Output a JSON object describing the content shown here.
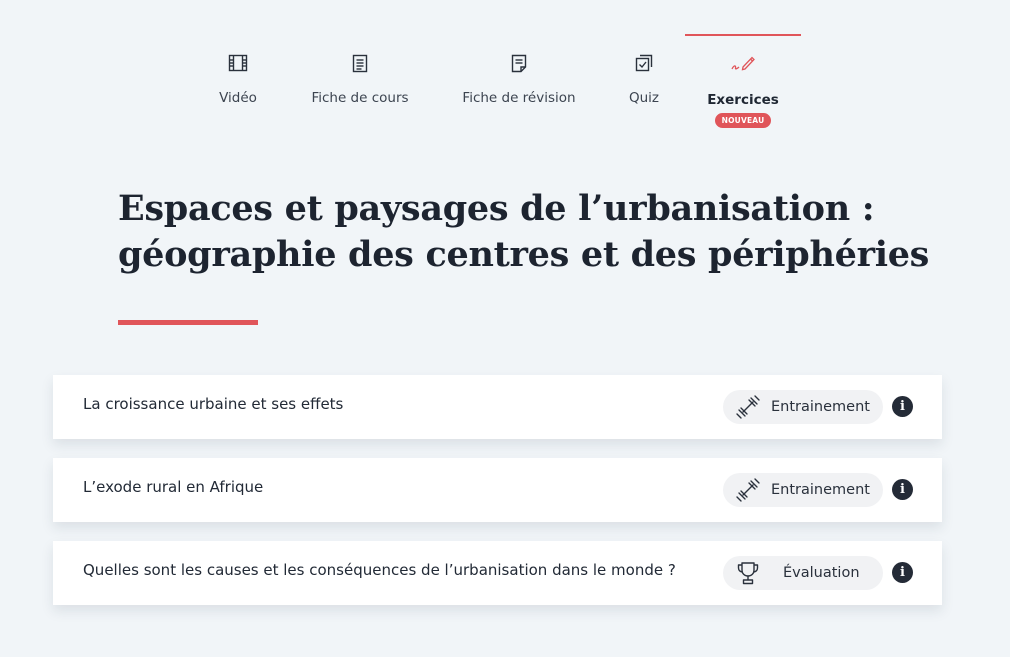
{
  "tabs": [
    {
      "label": "Vidéo",
      "icon": "film-icon"
    },
    {
      "label": "Fiche de cours",
      "icon": "document-icon"
    },
    {
      "label": "Fiche de révision",
      "icon": "revision-sheet-icon"
    },
    {
      "label": "Quiz",
      "icon": "quiz-icon"
    },
    {
      "label": "Exercices",
      "icon": "pen-icon",
      "badge": "NOUVEAU",
      "active": true
    }
  ],
  "page": {
    "title_line1": "Espaces et paysages de l’urbanisation :",
    "title_line2": "géographie des centres et des périphéries"
  },
  "exercises": [
    {
      "title": "La croissance urbaine et ses effets",
      "type_label": "Entrainement",
      "type_icon": "dumbbell-icon",
      "info": "i"
    },
    {
      "title": "L’exode rural en Afrique",
      "type_label": "Entrainement",
      "type_icon": "dumbbell-icon",
      "info": "i"
    },
    {
      "title": "Quelles sont les causes et les conséquences de l’urbanisation dans le monde ?",
      "type_label": "Évaluation",
      "type_icon": "trophy-icon",
      "info": "i"
    }
  ],
  "colors": {
    "accent": "#e0555a",
    "background": "#f1f5f8",
    "text": "#1d2430",
    "info_badge": "#242b37"
  }
}
